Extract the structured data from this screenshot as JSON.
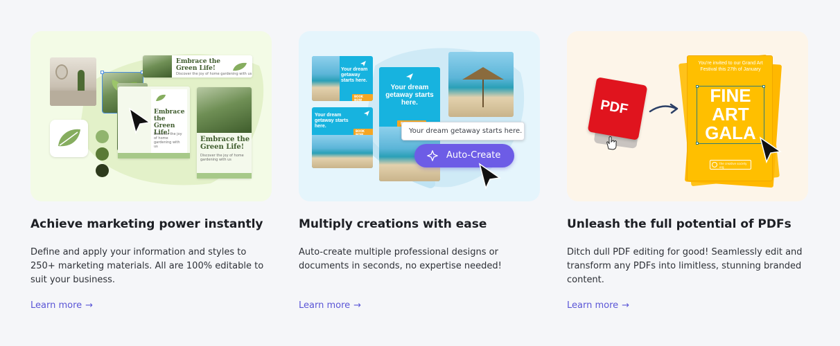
{
  "cards": [
    {
      "title": "Achieve marketing power instantly",
      "description": "Define and apply your information and styles to 250+ marketing materials. All are 100% editable to suit your business.",
      "link": "Learn more",
      "arrow": "→",
      "illustration": {
        "headline_1": "Embrace the Green Life!",
        "headline_2": "Embrace the Green Life!",
        "headline_3": "Embrace the Green Life!",
        "tagline": "Discover the joy of home gardening with us",
        "colors": [
          "#91b46e",
          "#5a7a36",
          "#2d3a1c"
        ]
      }
    },
    {
      "title": "Multiply creations with ease",
      "description": "Auto-create multiple professional designs or documents in seconds, no expertise needed!",
      "link": "Learn more",
      "arrow": "→",
      "illustration": {
        "ad_text_large": "Your dream getaway starts here.",
        "ad_text_small_1": "Your dream getaway starts here.",
        "ad_text_small_2": "Your dream getaway starts here.",
        "book_now": "BOOK NOW",
        "prompt_text": "Your dream getaway starts here.",
        "button_label": "Auto-Create"
      }
    },
    {
      "title": "Unleash the full potential of PDFs",
      "description": "Ditch dull PDF editing for good! Seamlessly edit and transform any PDFs into limitless, stunning branded content.",
      "link": "Learn more",
      "arrow": "→",
      "illustration": {
        "pdf_label": "PDF",
        "invite_line": "You're invited to our Grand Art Festival this 27th of January",
        "poster_title_1": "FINE",
        "poster_title_2": "ART",
        "poster_title_3": "GALA",
        "org_name": "the creative society org"
      }
    }
  ],
  "colors": {
    "page_bg": "#f5f6f9",
    "link": "#5a55d6",
    "auto_create_button": "#6d5ce6",
    "pdf_red": "#e0141e",
    "poster_yellow": "#ffbf00",
    "ad_cyan": "#17b3df"
  }
}
